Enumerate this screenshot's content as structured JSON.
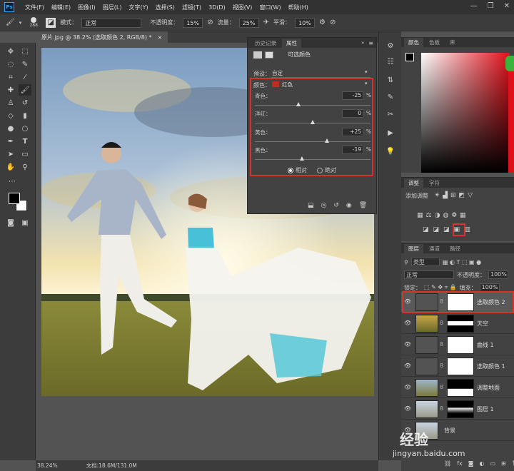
{
  "menu": {
    "logo": "Ps",
    "items": [
      "文件(F)",
      "编辑(E)",
      "图像(I)",
      "图层(L)",
      "文字(Y)",
      "选择(S)",
      "滤镜(T)",
      "3D(D)",
      "视图(V)",
      "窗口(W)",
      "帮助(H)"
    ],
    "window_controls": [
      "—",
      "❐",
      "✕"
    ]
  },
  "options": {
    "brush_size": "288",
    "mode_label": "模式：",
    "mode_value": "正常",
    "opacity_label": "不透明度：",
    "opacity_value": "15%",
    "flow_label": "流量：",
    "flow_value": "25%",
    "smooth_label": "平滑：",
    "smooth_value": "10%"
  },
  "document": {
    "tab_title": "原片.jpg @ 38.2% (选取颜色 2, RGB/8) *",
    "tab_close": "×",
    "zoom": "38.24%",
    "doc_size": "文档:18.6M/131.0M"
  },
  "properties": {
    "tab_history": "历史记录",
    "tab_properties": "属性",
    "title": "可选颜色",
    "preset_label": "预设：",
    "preset_value": "自定",
    "colors_label": "颜色：",
    "colors_value": "红色",
    "colors_swatch": "#c8281e",
    "sliders": [
      {
        "label": "青色：",
        "value": "-25",
        "pct": "%",
        "level": -25
      },
      {
        "label": "洋红：",
        "value": "0",
        "pct": "%",
        "level": 0
      },
      {
        "label": "黄色：",
        "value": "+25",
        "pct": "%",
        "level": 25
      },
      {
        "label": "黑色：",
        "value": "-19",
        "pct": "%",
        "level": -19
      }
    ],
    "radio_relative": "相对",
    "radio_absolute": "绝对"
  },
  "color_panel": {
    "tab_color": "颜色",
    "tab_swatches": "色板",
    "tab_library": "库"
  },
  "adjust_panel": {
    "tab_adjust": "调整",
    "tab_char": "字符",
    "add_label": "添加调整"
  },
  "layers_panel": {
    "tab_layers": "图层",
    "tab_channels": "通道",
    "tab_paths": "路径",
    "filter_value": "类型",
    "blend_value": "正常",
    "opacity_label": "不透明度：",
    "opacity_value": "100%",
    "lock_label": "锁定：",
    "fill_label": "填充：",
    "fill_value": "100%",
    "layers": [
      {
        "name": "选取颜色 2",
        "selected": true
      },
      {
        "name": "天空",
        "selected": false
      },
      {
        "name": "曲线 1",
        "selected": false
      },
      {
        "name": "选取颜色 1",
        "selected": false
      },
      {
        "name": "调整地面",
        "selected": false
      },
      {
        "name": "图层 1",
        "selected": false
      },
      {
        "name": "背景",
        "selected": false
      }
    ]
  },
  "watermark": {
    "text": "经验",
    "url": "jingyan.baidu.com"
  },
  "colors": {
    "highlight_red": "#d9312d",
    "foreground": "#000000",
    "background": "#ffffff"
  }
}
